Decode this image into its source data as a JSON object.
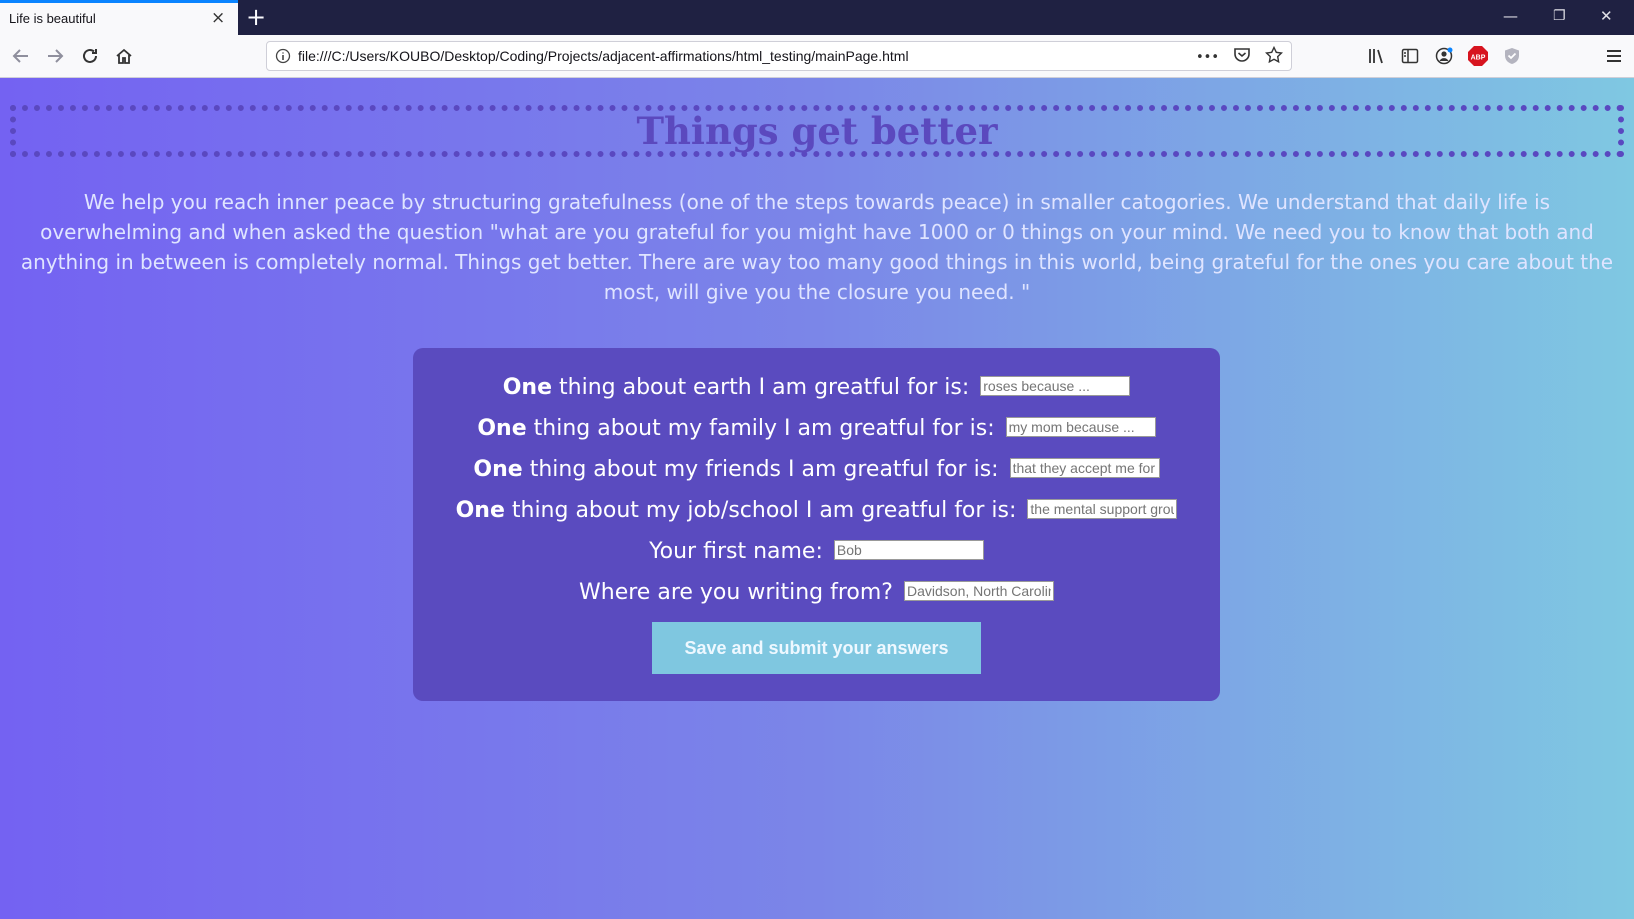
{
  "browser": {
    "tab_title": "Life is beautiful",
    "tab_close": "×",
    "new_tab": "+",
    "url": "file:///C:/Users/KOUBO/Desktop/Coding/Projects/adjacent-affirmations/html_testing/mainPage.html",
    "url_more": "•••",
    "window_controls": {
      "minimize": "—",
      "restore": "❐",
      "close": "✕"
    },
    "extension_badge": "ABP"
  },
  "page": {
    "title": "Things get better",
    "intro": "We help you reach inner peace by structuring gratefulness (one of the steps towards peace) in smaller catogories. We understand that daily life is overwhelming and when asked the question \"what are you grateful for you might have 1000 or 0 things on your mind. We need you to know that both and anything in between is completely normal. Things get better. There are way too many good things in this world, being grateful for the ones you care about the most, will give you the closure you need. \""
  },
  "form": {
    "rows": [
      {
        "bold": "One",
        "label": " thing about earth I am greatful for is: ",
        "placeholder": "roses because ..."
      },
      {
        "bold": "One",
        "label": " thing about my family I am greatful for is: ",
        "placeholder": "my mom because ..."
      },
      {
        "bold": "One",
        "label": " thing about my friends I am greatful for is: ",
        "placeholder": "that they accept me for"
      },
      {
        "bold": "One",
        "label": " thing about my job/school I am greatful for is: ",
        "placeholder": "the mental support grou"
      },
      {
        "bold": "",
        "label": "Your first name: ",
        "placeholder": "Bob"
      },
      {
        "bold": "",
        "label": "Where are you writing from? ",
        "placeholder": "Davidson, North Carolin"
      }
    ],
    "submit_label": "Save and submit your answers"
  },
  "colors": {
    "gradient_start": "#7462f2",
    "gradient_end": "#7fc8e2",
    "card": "#5a4bbf",
    "title": "#5b49be",
    "button": "#7fc7e0"
  }
}
